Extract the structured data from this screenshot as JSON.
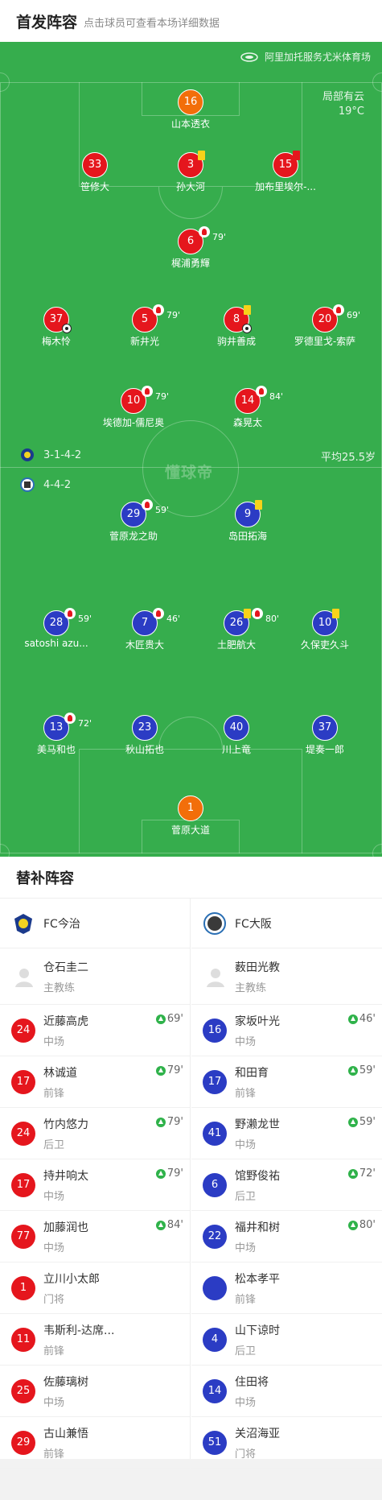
{
  "header": {
    "title": "首发阵容",
    "subtitle": "点击球员可查看本场详细数据"
  },
  "pitch": {
    "venue": "阿里加托服务尤米体育场",
    "weather": "局部有云",
    "temperature": "19°C",
    "watermark": "懂球帝",
    "home_formation": "3-1-4-2",
    "away_formation": "4-4-2",
    "average_age": "平均25.5岁",
    "colors": {
      "pitch": "#36ad4d",
      "home": "#e5161d",
      "away": "#2b3cc4",
      "goalkeeper": "#f26e0a"
    }
  },
  "home_players": [
    {
      "number": "16",
      "name": "山本透衣",
      "color": "orange"
    },
    {
      "number": "33",
      "name": "笹修大",
      "color": "red"
    },
    {
      "number": "3",
      "name": "孙大河",
      "color": "red",
      "card": "yellow"
    },
    {
      "number": "15",
      "name": "加布里埃尔-...",
      "color": "red",
      "card": "red"
    },
    {
      "number": "6",
      "name": "梶浦勇輝",
      "color": "red",
      "sub_off": "79'"
    },
    {
      "number": "37",
      "name": "梅木怜",
      "color": "red",
      "goal": true
    },
    {
      "number": "5",
      "name": "新井光",
      "color": "red",
      "sub_off": "79'"
    },
    {
      "number": "8",
      "name": "驹井善成",
      "color": "red",
      "card": "yellow",
      "goal": true
    },
    {
      "number": "20",
      "name": "罗德里戈-索萨",
      "color": "red",
      "sub_off": "69'"
    },
    {
      "number": "10",
      "name": "埃德加-儒尼奥",
      "color": "red",
      "sub_off": "79'"
    },
    {
      "number": "14",
      "name": "森晃太",
      "color": "red",
      "sub_off": "84'"
    }
  ],
  "away_players": [
    {
      "number": "29",
      "name": "菅原龙之助",
      "color": "blue",
      "sub_off": "59'"
    },
    {
      "number": "9",
      "name": "岛田拓海",
      "color": "blue",
      "card": "yellow"
    },
    {
      "number": "28",
      "name": "satoshi azu...",
      "color": "blue",
      "sub_off": "59'"
    },
    {
      "number": "7",
      "name": "木匠贵大",
      "color": "blue",
      "sub_off": "46'"
    },
    {
      "number": "26",
      "name": "土肥航大",
      "color": "blue",
      "card": "yellow",
      "sub_off": "80'"
    },
    {
      "number": "10",
      "name": "久保吏久斗",
      "color": "blue",
      "card": "yellow"
    },
    {
      "number": "13",
      "name": "美马和也",
      "color": "blue",
      "sub_off": "72'"
    },
    {
      "number": "23",
      "name": "秋山拓也",
      "color": "blue"
    },
    {
      "number": "40",
      "name": "川上竜",
      "color": "blue"
    },
    {
      "number": "37",
      "name": "堤奏一郎",
      "color": "blue"
    },
    {
      "number": "1",
      "name": "菅原大道",
      "color": "orange"
    }
  ],
  "subs": {
    "title": "替补阵容",
    "home": {
      "team": "FC今治",
      "coach": {
        "name": "仓石圭二",
        "role": "主教练"
      },
      "players": [
        {
          "number": "24",
          "name": "近藤高虎",
          "pos": "中场",
          "sub_in": "69'"
        },
        {
          "number": "17",
          "name": "林诚道",
          "pos": "前锋",
          "sub_in": "79'"
        },
        {
          "number": "24",
          "name": "竹内悠力",
          "pos": "后卫",
          "sub_in": "79'"
        },
        {
          "number": "17",
          "name": "持井响太",
          "pos": "中场",
          "sub_in": "79'"
        },
        {
          "number": "77",
          "name": "加藤润也",
          "pos": "中场",
          "sub_in": "84'"
        },
        {
          "number": "1",
          "name": "立川小太郎",
          "pos": "门将"
        },
        {
          "number": "11",
          "name": "韦斯利-达席...",
          "pos": "前锋"
        },
        {
          "number": "25",
          "name": "佐藤璃树",
          "pos": "中场"
        },
        {
          "number": "29",
          "name": "古山兼悟",
          "pos": "前锋"
        }
      ]
    },
    "away": {
      "team": "FC大阪",
      "coach": {
        "name": "薮田光教",
        "role": "主教练"
      },
      "players": [
        {
          "number": "16",
          "name": "家坂叶光",
          "pos": "中场",
          "sub_in": "46'"
        },
        {
          "number": "17",
          "name": "和田育",
          "pos": "前锋",
          "sub_in": "59'"
        },
        {
          "number": "41",
          "name": "野濑龙世",
          "pos": "中场",
          "sub_in": "59'"
        },
        {
          "number": "6",
          "name": "馆野俊祐",
          "pos": "后卫",
          "sub_in": "72'"
        },
        {
          "number": "22",
          "name": "福井和树",
          "pos": "中场",
          "sub_in": "80'"
        },
        {
          "number": "",
          "name": "松本孝平",
          "pos": "前锋"
        },
        {
          "number": "4",
          "name": "山下谅时",
          "pos": "后卫"
        },
        {
          "number": "14",
          "name": "住田将",
          "pos": "中场"
        },
        {
          "number": "51",
          "name": "关沼海亚",
          "pos": "门将"
        }
      ]
    }
  }
}
